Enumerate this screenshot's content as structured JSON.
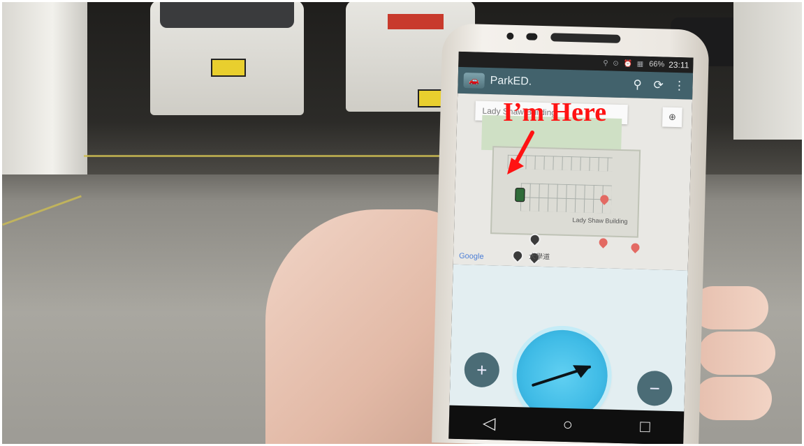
{
  "status_bar": {
    "time": "23:11",
    "battery": "66%"
  },
  "app": {
    "title": "ParkED."
  },
  "map": {
    "search_text": "Lady Shaw Building",
    "building_label": "Lady Shaw Building",
    "road_label": "大學道",
    "attribution": "Google",
    "car_marker": "car-marker"
  },
  "controls": {
    "zoom_in": "+",
    "zoom_out": "−"
  },
  "overlay": {
    "annotation_text": "I’m Here",
    "annotation_color": "#ff1313"
  },
  "icons": {
    "search": "search-icon",
    "refresh": "refresh-icon",
    "more": "more-vert-icon",
    "locate": "my-location-icon",
    "compass_arrow": "direction-arrow-icon",
    "back": "back-icon",
    "home": "home-icon",
    "recents": "recents-icon"
  }
}
